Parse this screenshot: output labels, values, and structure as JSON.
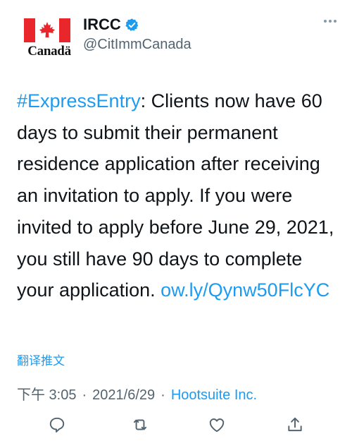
{
  "author": {
    "logo_wordmark": "Canadä",
    "display_name": "IRCC",
    "handle": "@CitImmCanada",
    "verified_icon": "verified-badge-icon"
  },
  "tweet": {
    "hashtag": "#ExpressEntry",
    "text": ": Clients now have 60 days to submit their permanent residence application after receiving an invitation to apply. If you were invited to apply before June 29, 2021, you still have 90 days to complete your application. ",
    "link": "ow.ly/Qynw50FlcYC",
    "translate_label": "翻译推文"
  },
  "meta": {
    "time": "下午 3:05",
    "separator": "·",
    "date": "2021/6/29",
    "source": "Hootsuite Inc."
  },
  "actions": [
    "reply-icon",
    "retweet-icon",
    "like-icon",
    "share-icon"
  ],
  "colors": {
    "accent": "#1d9bf0",
    "text": "#0f1419",
    "secondary": "#536471",
    "flag_red": "#e8262b"
  }
}
